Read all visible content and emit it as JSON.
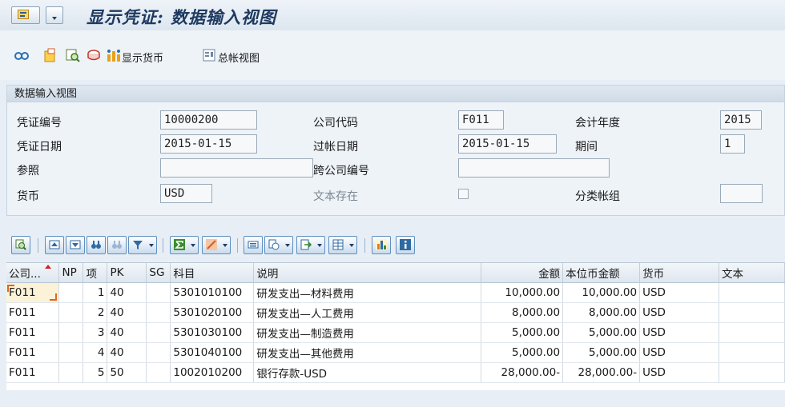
{
  "title": "显示凭证: 数据输入视图",
  "app_toolbar": {
    "display_currency": "显示货币",
    "general_ledger_view": "总帐视图"
  },
  "header_panel": {
    "title": "数据输入视图",
    "doc_number_label": "凭证编号",
    "doc_number": "10000200",
    "company_code_label": "公司代码",
    "company_code": "F011",
    "fiscal_year_label": "会计年度",
    "fiscal_year": "2015",
    "doc_date_label": "凭证日期",
    "doc_date": "2015-01-15",
    "posting_date_label": "过帐日期",
    "posting_date": "2015-01-15",
    "period_label": "期间",
    "period": "1",
    "reference_label": "参照",
    "reference": "",
    "cross_company_label": "跨公司编号",
    "cross_company": "",
    "currency_label": "货币",
    "currency": "USD",
    "text_exists_label": "文本存在",
    "ledger_group_label": "分类帐组",
    "ledger_group": ""
  },
  "table": {
    "columns": [
      "公司...",
      "NP",
      "项",
      "PK",
      "SG",
      "科目",
      "说明",
      "金额",
      "本位币金额",
      "货币",
      "文本"
    ],
    "rows": [
      {
        "company": "F011",
        "np": "",
        "item": "1",
        "pk": "40",
        "sg": "",
        "account": "5301010100",
        "desc": "研发支出—材料费用",
        "amount": "10,000.00",
        "local_amount": "10,000.00",
        "currency": "USD",
        "text": ""
      },
      {
        "company": "F011",
        "np": "",
        "item": "2",
        "pk": "40",
        "sg": "",
        "account": "5301020100",
        "desc": "研发支出—人工费用",
        "amount": "8,000.00",
        "local_amount": "8,000.00",
        "currency": "USD",
        "text": ""
      },
      {
        "company": "F011",
        "np": "",
        "item": "3",
        "pk": "40",
        "sg": "",
        "account": "5301030100",
        "desc": "研发支出—制造费用",
        "amount": "5,000.00",
        "local_amount": "5,000.00",
        "currency": "USD",
        "text": ""
      },
      {
        "company": "F011",
        "np": "",
        "item": "4",
        "pk": "40",
        "sg": "",
        "account": "5301040100",
        "desc": "研发支出—其他费用",
        "amount": "5,000.00",
        "local_amount": "5,000.00",
        "currency": "USD",
        "text": ""
      },
      {
        "company": "F011",
        "np": "",
        "item": "5",
        "pk": "50",
        "sg": "",
        "account": "1002010200",
        "desc": "银行存款-USD",
        "amount": "28,000.00-",
        "local_amount": "28,000.00-",
        "currency": "USD",
        "text": ""
      }
    ]
  },
  "colors": {
    "title": "#1f3a60",
    "accent": "#5e8fbf",
    "sort_marker": "#d52020",
    "selected_cell": "#fbf2d7"
  }
}
